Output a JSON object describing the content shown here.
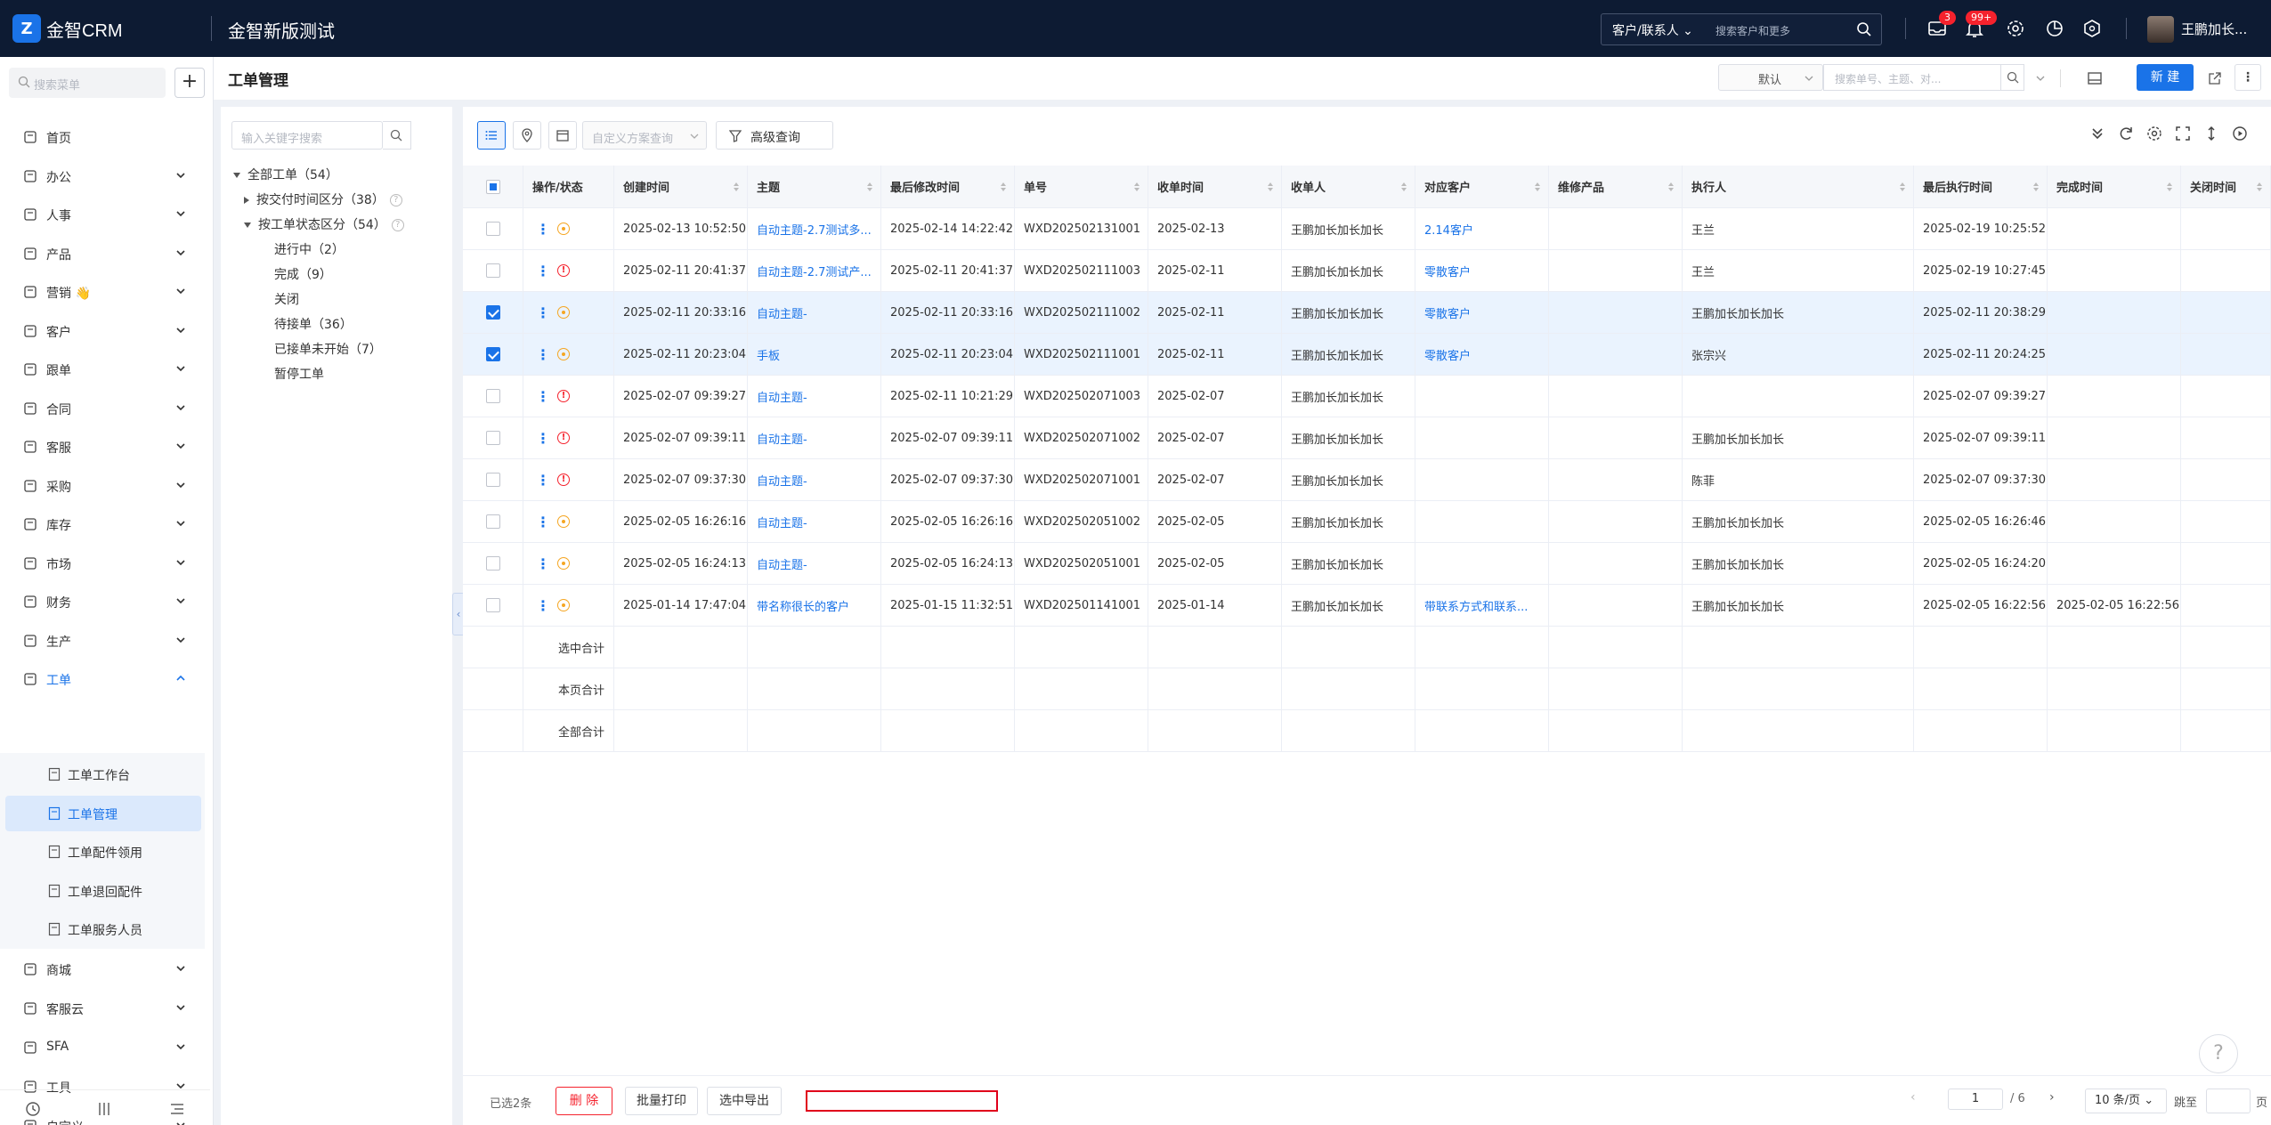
{
  "topbar": {
    "brand": "金智CRM",
    "logo_letter": "Z",
    "system_title": "金智新版测试",
    "search_type": "客户/联系人",
    "search_placeholder": "搜索客户和更多",
    "mail_badge": "3",
    "bell_badge": "99+",
    "user_name": "王鹏加长..."
  },
  "sidebar": {
    "search_placeholder": "搜索菜单",
    "add_label": "+",
    "items": [
      {
        "label": "首页"
      },
      {
        "label": "办公"
      },
      {
        "label": "人事"
      },
      {
        "label": "产品"
      },
      {
        "label": "营销 👋"
      },
      {
        "label": "客户"
      },
      {
        "label": "跟单"
      },
      {
        "label": "合同"
      },
      {
        "label": "客服"
      },
      {
        "label": "采购"
      },
      {
        "label": "库存"
      },
      {
        "label": "市场"
      },
      {
        "label": "财务"
      },
      {
        "label": "生产"
      },
      {
        "label": "工单"
      }
    ],
    "sub_items": [
      {
        "label": "工单工作台"
      },
      {
        "label": "工单管理"
      },
      {
        "label": "工单配件领用"
      },
      {
        "label": "工单退回配件"
      },
      {
        "label": "工单服务人员"
      }
    ],
    "items_after": [
      {
        "label": "商城"
      },
      {
        "label": "客服云"
      },
      {
        "label": "SFA"
      },
      {
        "label": "工具"
      },
      {
        "label": "自定义"
      }
    ]
  },
  "page": {
    "title": "工单管理",
    "view_select": "默认",
    "search_placeholder": "搜索单号、主题、对...",
    "new_button": "新 建"
  },
  "tree": {
    "search_placeholder": "输入关键字搜索",
    "root": "全部工单（54）",
    "group1": "按交付时间区分（38）",
    "group2": "按工单状态区分（54）",
    "children": [
      "进行中（2）",
      "完成（9）",
      "关闭",
      "待接单（36）",
      "已接单未开始（7）",
      "暂停工单"
    ]
  },
  "toolbar": {
    "custom_scheme_placeholder": "自定义方案查询",
    "advanced_query": "高级查询"
  },
  "table": {
    "headers": [
      "操作/状态",
      "创建时间",
      "主题",
      "最后修改时间",
      "单号",
      "收单时间",
      "收单人",
      "对应客户",
      "维修产品",
      "执行人",
      "最后执行时间",
      "完成时间",
      "关闭时间"
    ],
    "rows": [
      {
        "checked": false,
        "status": "orange",
        "created": "2025-02-13 10:52:50",
        "subject": "自动主题-2.7测试多...",
        "modified": "2025-02-14 14:22:42",
        "no": "WXD202502131001",
        "received": "2025-02-13",
        "receiver": "王鹏加长加长加长",
        "customer": "2.14客户",
        "product": "",
        "executor": "王兰",
        "last_exec": "2025-02-19 10:25:52",
        "done": "",
        "closed": ""
      },
      {
        "checked": false,
        "status": "red",
        "created": "2025-02-11 20:41:37",
        "subject": "自动主题-2.7测试产...",
        "modified": "2025-02-11 20:41:37",
        "no": "WXD202502111003",
        "received": "2025-02-11",
        "receiver": "王鹏加长加长加长",
        "customer": "零散客户",
        "product": "",
        "executor": "王兰",
        "last_exec": "2025-02-19 10:27:45",
        "done": "",
        "closed": ""
      },
      {
        "checked": true,
        "status": "orange",
        "created": "2025-02-11 20:33:16",
        "subject": "自动主题-",
        "modified": "2025-02-11 20:33:16",
        "no": "WXD202502111002",
        "received": "2025-02-11",
        "receiver": "王鹏加长加长加长",
        "customer": "零散客户",
        "product": "",
        "executor": "王鹏加长加长加长",
        "last_exec": "2025-02-11 20:38:29",
        "done": "",
        "closed": ""
      },
      {
        "checked": true,
        "status": "orange",
        "created": "2025-02-11 20:23:04",
        "subject": "手板",
        "modified": "2025-02-11 20:23:04",
        "no": "WXD202502111001",
        "received": "2025-02-11",
        "receiver": "王鹏加长加长加长",
        "customer": "零散客户",
        "product": "",
        "executor": "张宗兴",
        "last_exec": "2025-02-11 20:24:25",
        "done": "",
        "closed": ""
      },
      {
        "checked": false,
        "status": "red",
        "created": "2025-02-07 09:39:27",
        "subject": "自动主题-",
        "modified": "2025-02-11 10:21:29",
        "no": "WXD202502071003",
        "received": "2025-02-07",
        "receiver": "王鹏加长加长加长",
        "customer": "",
        "product": "",
        "executor": "",
        "last_exec": "2025-02-07 09:39:27",
        "done": "",
        "closed": ""
      },
      {
        "checked": false,
        "status": "red",
        "created": "2025-02-07 09:39:11",
        "subject": "自动主题-",
        "modified": "2025-02-07 09:39:11",
        "no": "WXD202502071002",
        "received": "2025-02-07",
        "receiver": "王鹏加长加长加长",
        "customer": "",
        "product": "",
        "executor": "王鹏加长加长加长",
        "last_exec": "2025-02-07 09:39:11",
        "done": "",
        "closed": ""
      },
      {
        "checked": false,
        "status": "red",
        "created": "2025-02-07 09:37:30",
        "subject": "自动主题-",
        "modified": "2025-02-07 09:37:30",
        "no": "WXD202502071001",
        "received": "2025-02-07",
        "receiver": "王鹏加长加长加长",
        "customer": "",
        "product": "",
        "executor": "陈菲",
        "last_exec": "2025-02-07 09:37:30",
        "done": "",
        "closed": ""
      },
      {
        "checked": false,
        "status": "orange",
        "created": "2025-02-05 16:26:16",
        "subject": "自动主题-",
        "modified": "2025-02-05 16:26:16",
        "no": "WXD202502051002",
        "received": "2025-02-05",
        "receiver": "王鹏加长加长加长",
        "customer": "",
        "product": "",
        "executor": "王鹏加长加长加长",
        "last_exec": "2025-02-05 16:26:46",
        "done": "",
        "closed": ""
      },
      {
        "checked": false,
        "status": "orange",
        "created": "2025-02-05 16:24:13",
        "subject": "自动主题-",
        "modified": "2025-02-05 16:24:13",
        "no": "WXD202502051001",
        "received": "2025-02-05",
        "receiver": "王鹏加长加长加长",
        "customer": "",
        "product": "",
        "executor": "王鹏加长加长加长",
        "last_exec": "2025-02-05 16:24:20",
        "done": "",
        "closed": ""
      },
      {
        "checked": false,
        "status": "orange",
        "created": "2025-01-14 17:47:04",
        "subject": "带名称很长的客户",
        "modified": "2025-01-15 11:32:51",
        "no": "WXD202501141001",
        "received": "2025-01-14",
        "receiver": "王鹏加长加长加长",
        "customer": "带联系方式和联系...",
        "product": "",
        "executor": "王鹏加长加长加长",
        "last_exec": "2025-02-05 16:22:56",
        "done": "2025-02-05 16:22:56",
        "closed": ""
      }
    ],
    "summaries": [
      "选中合计",
      "本页合计",
      "全部合计"
    ]
  },
  "footer": {
    "selected_count": "已选2条",
    "delete": "删 除",
    "batch_print": "批量打印",
    "export_selected": "选中导出",
    "current_page": "1",
    "total_pages": "/ 6",
    "page_size": "10 条/页",
    "jump_label": "跳至",
    "page_unit": "页"
  },
  "colors": {
    "accent": "#1a73e8",
    "topbar_bg": "#0d1b33",
    "danger": "#f5222d",
    "warning": "#f5a623"
  }
}
